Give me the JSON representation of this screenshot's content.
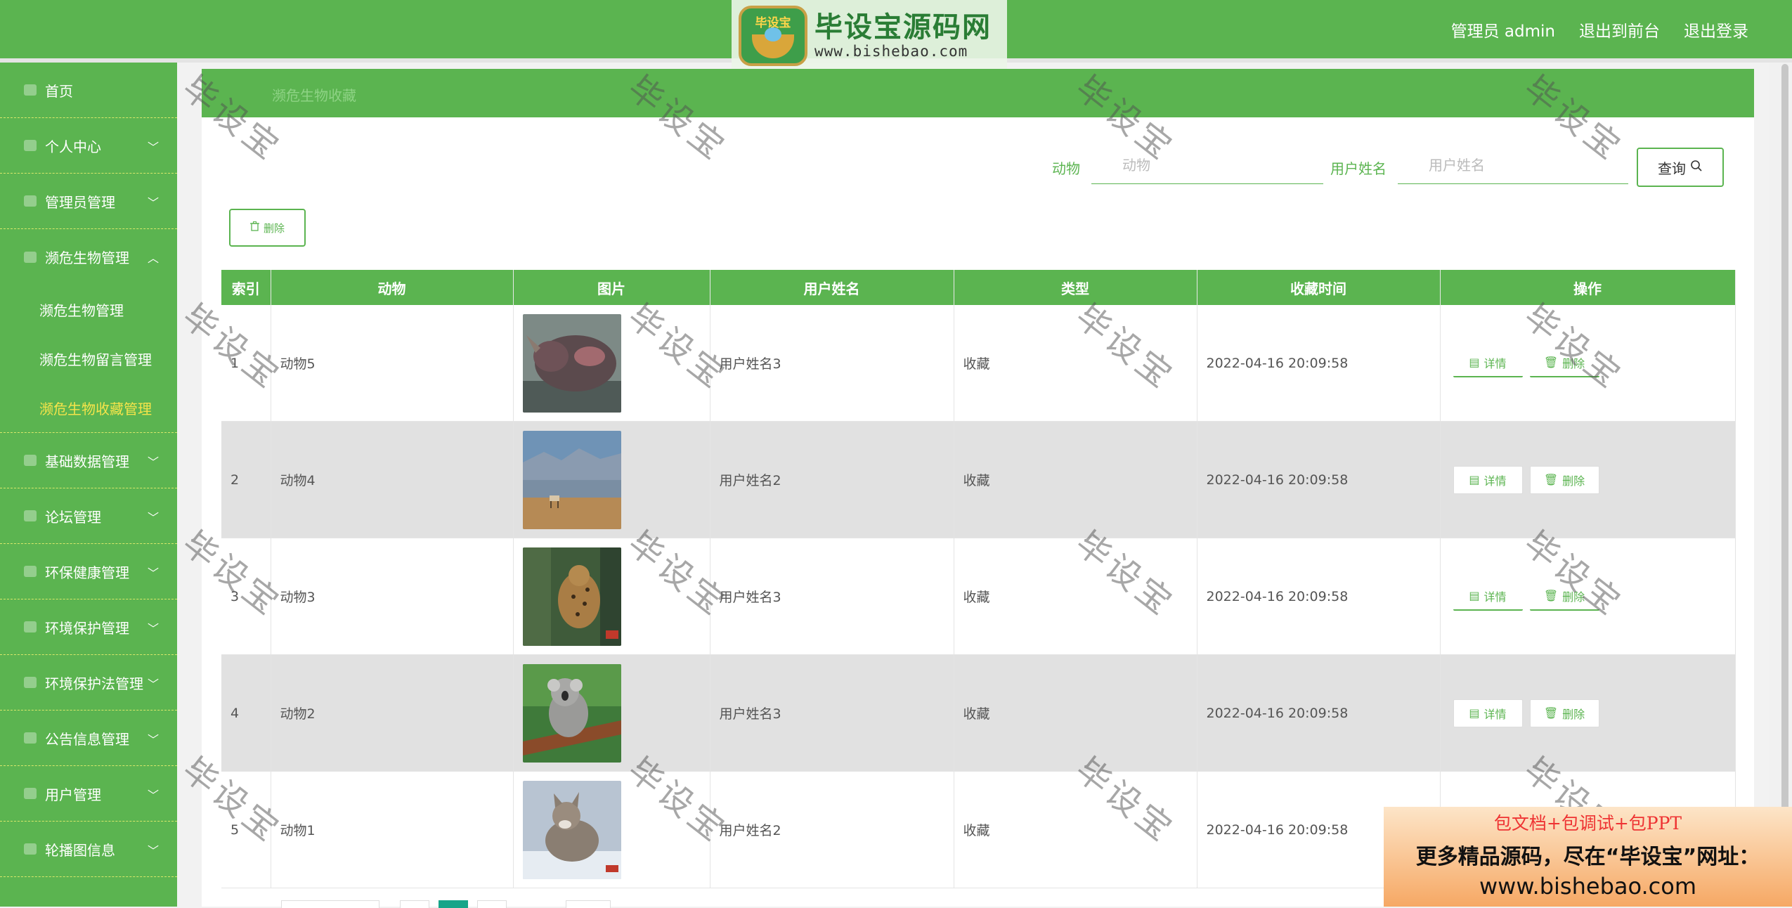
{
  "header": {
    "user_label": "管理员 admin",
    "front_link": "退出到前台",
    "logout_link": "退出登录",
    "logo_badge_text": "毕设宝",
    "logo_title": "毕设宝源码网",
    "logo_url": "www.bishebao.com"
  },
  "sidebar": {
    "home": "首页",
    "personal": "个人中心",
    "admin_mgmt": "管理员管理",
    "endangered_mgmt": "濒危生物管理",
    "sub_endangered": "濒危生物管理",
    "sub_comments": "濒危生物留言管理",
    "sub_favorites": "濒危生物收藏管理",
    "base_data": "基础数据管理",
    "forum": "论坛管理",
    "env_health": "环保健康管理",
    "env_protect": "环境保护管理",
    "env_law": "环境保护法管理",
    "notice": "公告信息管理",
    "users": "用户管理",
    "carousel": "轮播图信息"
  },
  "breadcrumb": "濒危生物收藏",
  "search": {
    "animal_label": "动物",
    "animal_placeholder": "动物",
    "user_label": "用户姓名",
    "user_placeholder": "用户姓名",
    "query_button": "查询"
  },
  "toolbar": {
    "delete_label": "删除"
  },
  "table": {
    "headers": [
      "索引",
      "动物",
      "图片",
      "用户姓名",
      "类型",
      "收藏时间",
      "操作"
    ],
    "detail_label": "详情",
    "delete_label": "删除",
    "rows": [
      {
        "index": "1",
        "animal": "动物5",
        "user": "用户姓名3",
        "type": "收藏",
        "time": "2022-04-16 20:09:58"
      },
      {
        "index": "2",
        "animal": "动物4",
        "user": "用户姓名2",
        "type": "收藏",
        "time": "2022-04-16 20:09:58"
      },
      {
        "index": "3",
        "animal": "动物3",
        "user": "用户姓名3",
        "type": "收藏",
        "time": "2022-04-16 20:09:58"
      },
      {
        "index": "4",
        "animal": "动物2",
        "user": "用户姓名3",
        "type": "收藏",
        "time": "2022-04-16 20:09:58"
      },
      {
        "index": "5",
        "animal": "动物1",
        "user": "用户姓名2",
        "type": "收藏",
        "time": "2022-04-16 20:09:58"
      }
    ]
  },
  "watermark_text": "毕设宝",
  "ad": {
    "line1": "包文档+包调试+包PPT",
    "line2": "更多精品源码，尽在“毕设宝”网址：",
    "line3": "www.bishebao.com"
  },
  "colors": {
    "primary": "#5bb450",
    "active_submenu": "#f5e44a",
    "row_alt": "#e1e1e1"
  }
}
